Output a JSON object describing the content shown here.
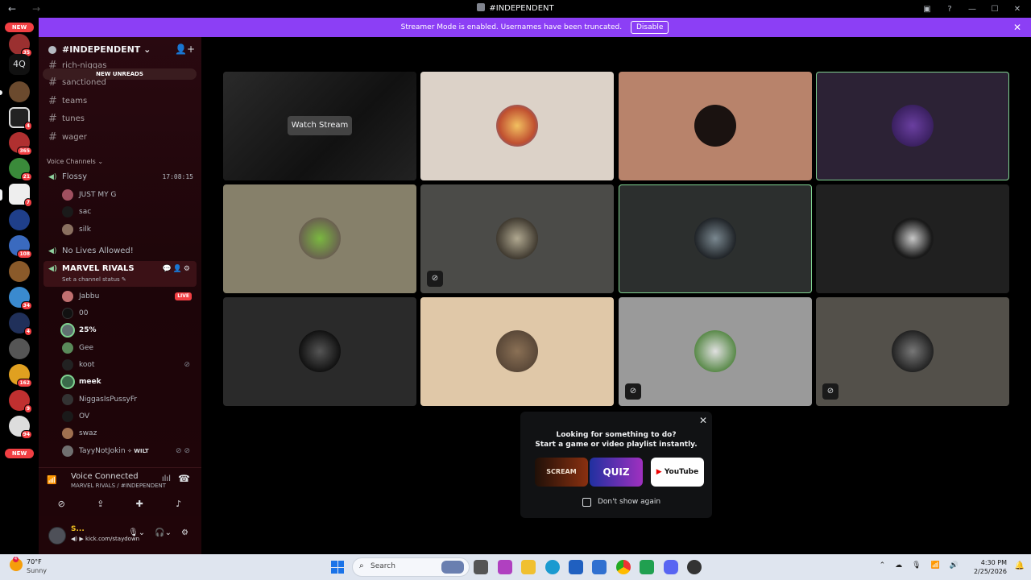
{
  "titlebar": {
    "title": "#INDEPENDENT",
    "back": "←",
    "forward": "→"
  },
  "banner": {
    "text": "Streamer Mode is enabled. Usernames have been truncated.",
    "disable_label": "Disable",
    "close": "✕"
  },
  "servers": [
    {
      "top": "NEW"
    },
    {
      "label": "35"
    },
    {
      "text": "4Q"
    },
    {
      "label": ""
    },
    {
      "label": "4"
    },
    {
      "label": "365"
    },
    {
      "label": "21"
    },
    {
      "label": "7"
    },
    {
      "label": ""
    },
    {
      "label": "108"
    },
    {
      "label": ""
    },
    {
      "label": "34"
    },
    {
      "label": "4"
    },
    {
      "label": ""
    },
    {
      "label": "162"
    },
    {
      "label": "9"
    },
    {
      "label": "94"
    },
    {
      "bottom": "NEW"
    }
  ],
  "guild": {
    "name": "#INDEPENDENT",
    "new_unreads": "NEW UNREADS"
  },
  "channels": [
    "rich-niggas",
    "sanctioned",
    "teams",
    "tunes",
    "wager"
  ],
  "voice_category": "Voice Channels",
  "voice": {
    "flossy": {
      "name": "Flossy",
      "timer": "17:08:15",
      "users": [
        "JUST MY G",
        "sac",
        "silk"
      ]
    },
    "nolives": {
      "name": "No Lives Allowed!"
    },
    "marvel": {
      "name": "MARVEL RIVALS",
      "status": "Set a channel status",
      "users": [
        {
          "name": "Jabbu",
          "live": "LIVE"
        },
        {
          "name": "00"
        },
        {
          "name": "25%"
        },
        {
          "name": "Gee"
        },
        {
          "name": "koot"
        },
        {
          "name": "meek"
        },
        {
          "name": "NiggasIsPussyFr"
        },
        {
          "name": "OV"
        },
        {
          "name": "swaz"
        },
        {
          "name": "TayyNotJokin",
          "tag": "✧ WILT"
        }
      ]
    }
  },
  "voice_connected": {
    "title": "Voice Connected",
    "sub": "MARVEL RIVALS / #INDEPENDENT"
  },
  "user_panel": {
    "name": "S...",
    "status": "kick.com/staydown"
  },
  "grid": {
    "watch_stream": "Watch Stream"
  },
  "activity": {
    "line1": "Looking for something to do?",
    "line2": "Start a game or video playlist instantly.",
    "apps": [
      "SCREAM",
      "QUIZ",
      "YouTube"
    ],
    "dont_show": "Don't show again"
  },
  "taskbar": {
    "temp": "70°F",
    "cond": "Sunny",
    "search": "Search",
    "time": "4:30 PM",
    "date": "2/25/2026",
    "weather_badge": "4"
  },
  "colors": {
    "accent": "#8c3ff5",
    "speaking": "#7fd290",
    "danger": "#f23f43"
  }
}
